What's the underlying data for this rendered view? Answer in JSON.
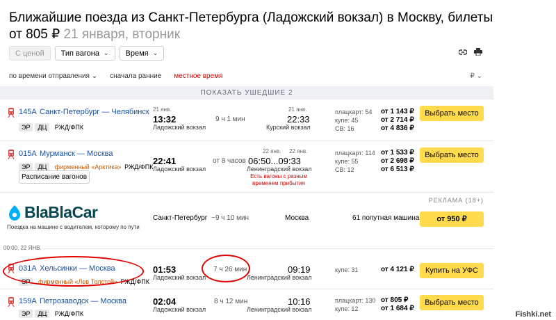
{
  "header": {
    "title_line1": "Ближайшие поезда из Санкт-Петербурга (Ладожский вокзал) в Москву, билеты",
    "price_prefix": "от 805 ₽",
    "date": "21 января, вторник"
  },
  "filters": {
    "price": "С ценой",
    "wagon_type": "Тип вагона",
    "time": "Время"
  },
  "sort": {
    "by_departure": "по времени отправления",
    "early_first": "сначала ранние",
    "local_time": "местное время",
    "currency": "₽"
  },
  "show_departed": "ПОКАЗАТЬ УШЕДШИЕ 2",
  "trains": [
    {
      "number": "145А",
      "route": "Санкт-Петербург — Челябинск",
      "tags": [
        "ЭР",
        "ДЦ"
      ],
      "brand": "",
      "carrier": "РЖД/ФПК",
      "dep_date": "21 янв.",
      "dep_time": "13:32",
      "dep_station": "Ладожский вокзал",
      "duration": "9 ч 1 мин",
      "arr_date": "21 янв.",
      "arr_time": "22:33",
      "arr_station": "Курский вокзал",
      "classes": [
        "плацкарт: 54",
        "купе: 45",
        "СВ: 16"
      ],
      "prices": [
        "от 1 143 ₽",
        "от 2 714 ₽",
        "от 4 836 ₽"
      ],
      "button": "Выбрать место"
    },
    {
      "number": "015А",
      "route": "Мурманск — Москва",
      "tags": [
        "ЭР",
        "ДЦ"
      ],
      "brand": "фирменный «Арктика»",
      "carrier": "РЖД/ФПК",
      "dep_date": "",
      "dep_time": "22:41",
      "dep_station": "Ладожский вокзал",
      "duration": "от 8 часов",
      "arr_date_1": "22 янв.",
      "arr_date_2": "22 янв.",
      "arr_time": "06:50...09:33",
      "arr_station": "Ленинградский вокзал",
      "warning": "Есть вагоны с разным временем прибытия",
      "classes": [
        "плацкарт: 114",
        "купе: 55",
        "СВ: 12"
      ],
      "prices": [
        "от 1 533 ₽",
        "от 2 698 ₽",
        "от 6 513 ₽"
      ],
      "button": "Выбрать место",
      "schedule_button": "Расписание вагонов"
    },
    {
      "number": "031А",
      "route": "Хельсинки — Москва",
      "tags": [
        "ЭР"
      ],
      "brand": "фирменный «Лев Толстой»",
      "carrier": "РЖД/ФПК",
      "dep_time": "01:53",
      "dep_station": "Ладожский вокзал",
      "duration": "7 ч 26 мин",
      "arr_time": "09:19",
      "arr_station": "Ленинградский вокзал",
      "classes": [
        "купе: 31"
      ],
      "prices": [
        "от 4 121 ₽"
      ],
      "button": "Купить на УФС"
    },
    {
      "number": "159А",
      "route": "Петрозаводск — Москва",
      "tags": [
        "ЭР",
        "ДЦ"
      ],
      "brand": "",
      "carrier": "РЖД/ФПК",
      "dep_time": "02:04",
      "dep_station": "Ладожский вокзал",
      "duration": "8 ч 12 мин",
      "arr_time": "10:16",
      "arr_station": "Ленинградский вокзал",
      "classes": [
        "плацкарт: 130",
        "купе: 12"
      ],
      "prices": [
        "от 805 ₽",
        "от 1 684 ₽"
      ],
      "button": "Выбрать место"
    }
  ],
  "ad": {
    "label": "РЕКЛАМА (18+)",
    "brand": "BlaBlaCar",
    "subtitle": "Поездка на машине с водителем, которому по пути",
    "from": "Санкт-Петербург",
    "duration": "~9 ч 10 мин",
    "to": "Москва",
    "cars": "61 попутная машина",
    "button": "от 950 ₽"
  },
  "date_separator": "00:00, 22 ЯНВ.",
  "watermark": "Fishki.net",
  "colors": {
    "link": "#1a4e9b",
    "accent_yellow": "#ffdb4d",
    "annotation_red": "#e00000",
    "brand_orange": "#c95a00"
  }
}
